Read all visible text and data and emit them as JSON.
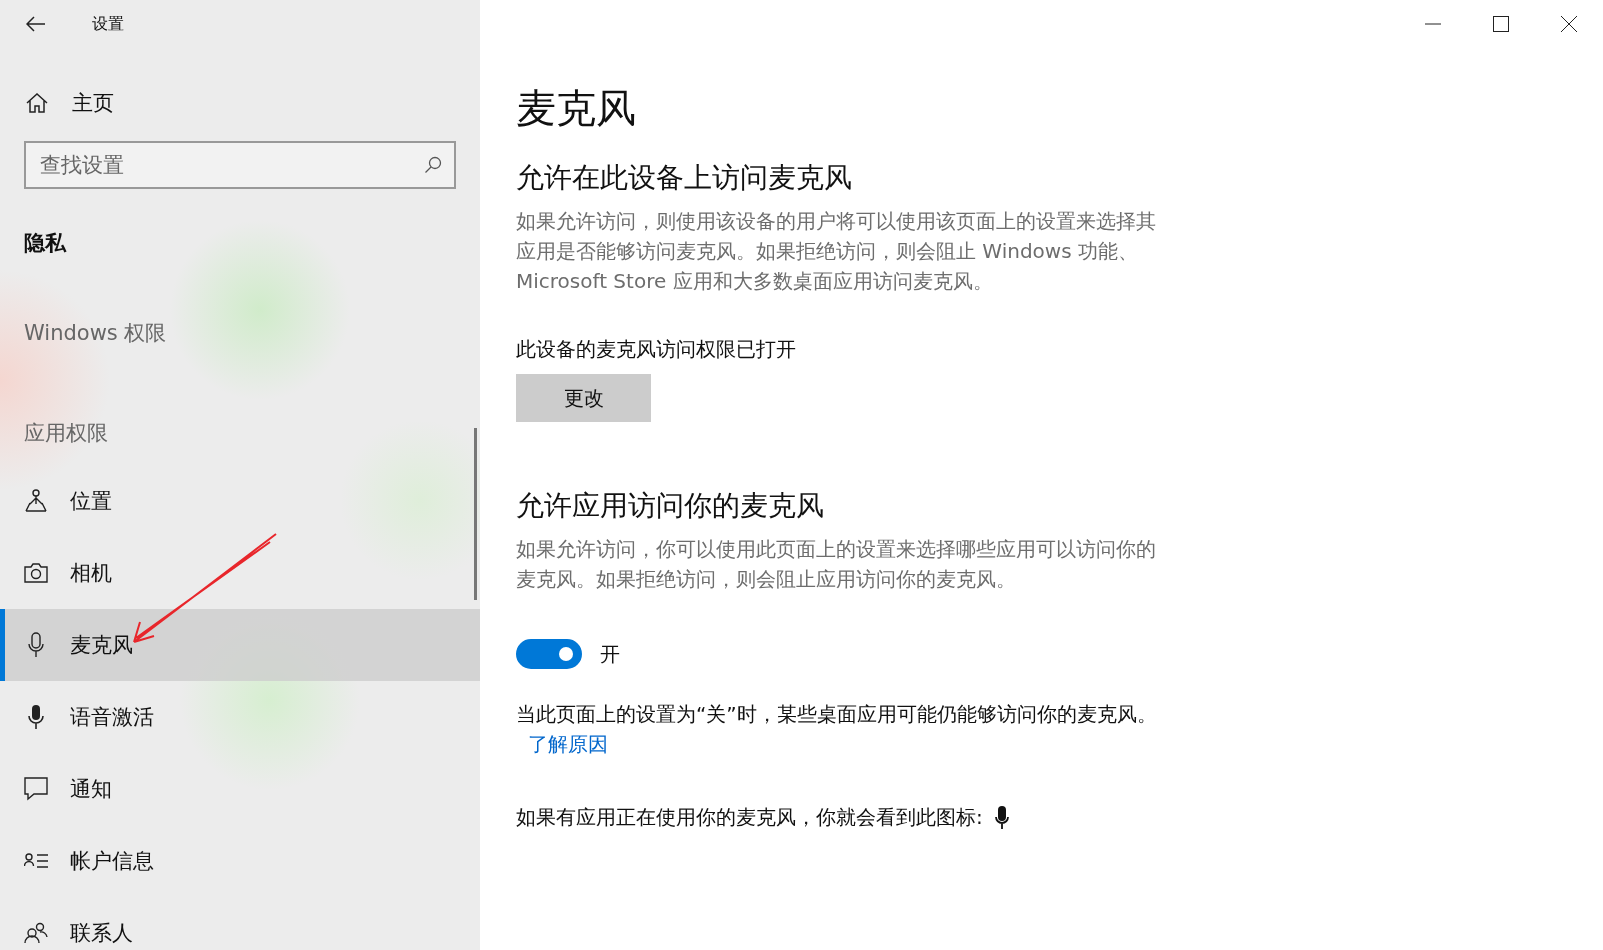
{
  "window": {
    "title": "设置"
  },
  "sidebar": {
    "home": "主页",
    "search": {
      "placeholder": "查找设置"
    },
    "section": "隐私",
    "groups": [
      {
        "label": "Windows 权限"
      },
      {
        "label": "应用权限"
      }
    ],
    "items": [
      {
        "label": "位置",
        "kind": "location",
        "selected": false
      },
      {
        "label": "相机",
        "kind": "camera",
        "selected": false
      },
      {
        "label": "麦克风",
        "kind": "microphone",
        "selected": true
      },
      {
        "label": "语音激活",
        "kind": "voice",
        "selected": false
      },
      {
        "label": "通知",
        "kind": "notification",
        "selected": false
      },
      {
        "label": "帐户信息",
        "kind": "account",
        "selected": false
      },
      {
        "label": "联系人",
        "kind": "contacts",
        "selected": false
      }
    ]
  },
  "page": {
    "title": "麦克风",
    "device": {
      "heading": "允许在此设备上访问麦克风",
      "description": "如果允许访问，则使用该设备的用户将可以使用该页面上的设置来选择其应用是否能够访问麦克风。如果拒绝访问，则会阻止 Windows 功能、Microsoft Store 应用和大多数桌面应用访问麦克风。",
      "status": "此设备的麦克风访问权限已打开",
      "button": "更改"
    },
    "apps": {
      "heading": "允许应用访问你的麦克风",
      "description": "如果允许访问，你可以使用此页面上的设置来选择哪些应用可以访问你的麦克风。如果拒绝访问，则会阻止应用访问你的麦克风。",
      "toggle": {
        "on": true,
        "label": "开"
      },
      "note": "当此页面上的设置为“关”时，某些桌面应用可能仍能够访问你的麦克风。",
      "link": "了解原因",
      "indicator": "如果有应用正在使用你的麦克风，你就会看到此图标:"
    }
  }
}
